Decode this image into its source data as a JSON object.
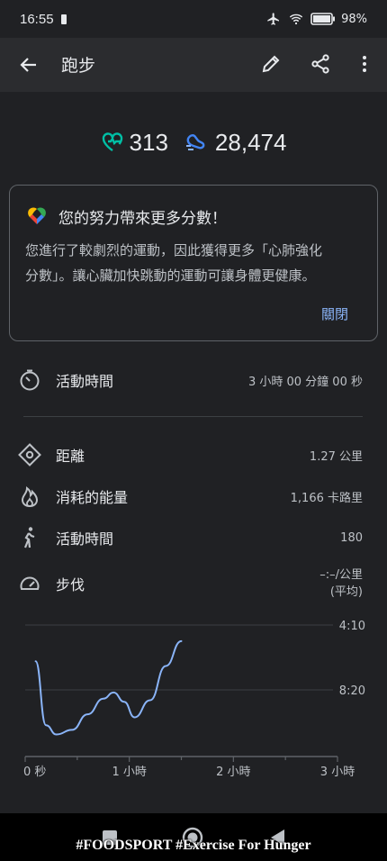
{
  "status_bar": {
    "time": "16:55",
    "battery": "98%"
  },
  "app_bar": {
    "title": "跑步"
  },
  "scores": {
    "heart_points": "313",
    "steps": "28,474",
    "heart_color": "#00bfa5",
    "steps_color": "#4285f4"
  },
  "card": {
    "title": "您的努力帶來更多分數！",
    "body_line1": "您進行了較劇烈的運動，因此獲得更多「心肺強化",
    "body_line2": "分數」。讓心臟加快跳動的運動可讓身體更健康。",
    "dismiss": "關閉"
  },
  "stats": [
    {
      "icon": "timer-icon",
      "label": "活動時間",
      "value": "3 小時 00 分鐘 00 秒"
    },
    {
      "icon": "location-pin-icon",
      "label": "距離",
      "value": "1.27 公里"
    },
    {
      "icon": "flame-icon",
      "label": "消耗的能量",
      "value": "1,166 卡路里"
    },
    {
      "icon": "walking-person-icon",
      "label": "活動時間",
      "value": "180"
    },
    {
      "icon": "speedometer-icon",
      "label": "步伐",
      "value_line1": "–:–/公里",
      "value_line2": "(平均)"
    }
  ],
  "chart_data": {
    "type": "line",
    "title": "",
    "xlabel": "",
    "ylabel": "",
    "x_tick_labels": [
      "0 秒",
      "1 小時",
      "2 小時",
      "3 小時"
    ],
    "y_tick_labels": [
      "4:10",
      "8:20"
    ],
    "series": [
      {
        "color": "#8ab4f8",
        "x_hours": [
          0.1,
          0.2,
          0.3,
          0.45,
          0.6,
          0.75,
          0.85,
          0.95,
          1.05,
          1.2,
          1.35,
          1.5
        ],
        "pace_min_per_km": [
          6.5,
          10.6,
          11.2,
          10.9,
          9.9,
          8.9,
          8.5,
          9.1,
          10.1,
          9.0,
          6.8,
          5.2
        ]
      }
    ],
    "x_range_hours": [
      0,
      3
    ],
    "y_range_pace": [
      4.1667,
      8.3333
    ],
    "y_inverted": true,
    "grid": true
  },
  "nav_bar": {
    "caption": "#FOODSPORT #Exercise For Hunger"
  }
}
